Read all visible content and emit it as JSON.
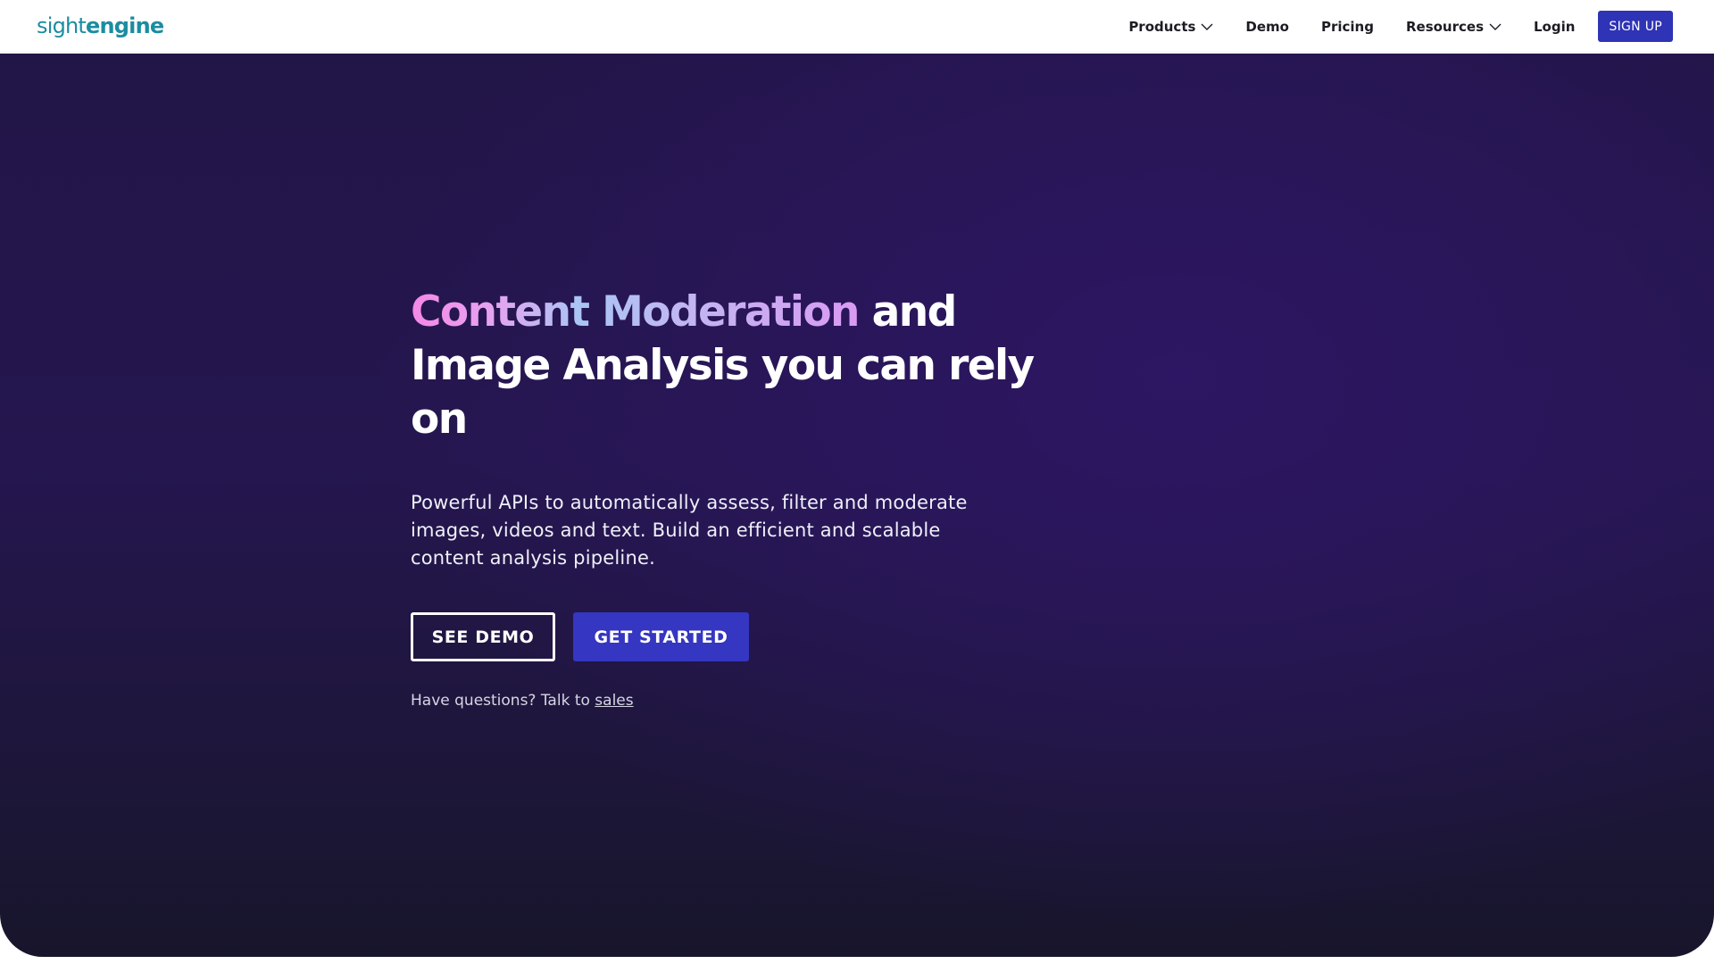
{
  "brand": {
    "logo_light": "sight",
    "logo_bold": "engine",
    "color": "#1b8da1"
  },
  "nav": {
    "products": "Products",
    "demo": "Demo",
    "pricing": "Pricing",
    "resources": "Resources",
    "login": "Login",
    "signup": "SIGN UP",
    "signup_color": "#2f33b5"
  },
  "hero": {
    "headline_highlight": "Content Moderation",
    "headline_rest": " and Image Analysis you can rely on",
    "description": "Powerful APIs to automatically assess, filter and moderate images, videos and text. Build an efficient and scalable content analysis pipeline.",
    "see_demo": "SEE DEMO",
    "get_started": "GET STARTED",
    "questions_prefix": "Have questions? Talk to ",
    "sales_link": "sales",
    "primary_color": "#3536c1",
    "background_color": "#221547"
  },
  "icons": {
    "products_dropdown": "chevron-down-icon",
    "resources_dropdown": "chevron-down-icon"
  }
}
